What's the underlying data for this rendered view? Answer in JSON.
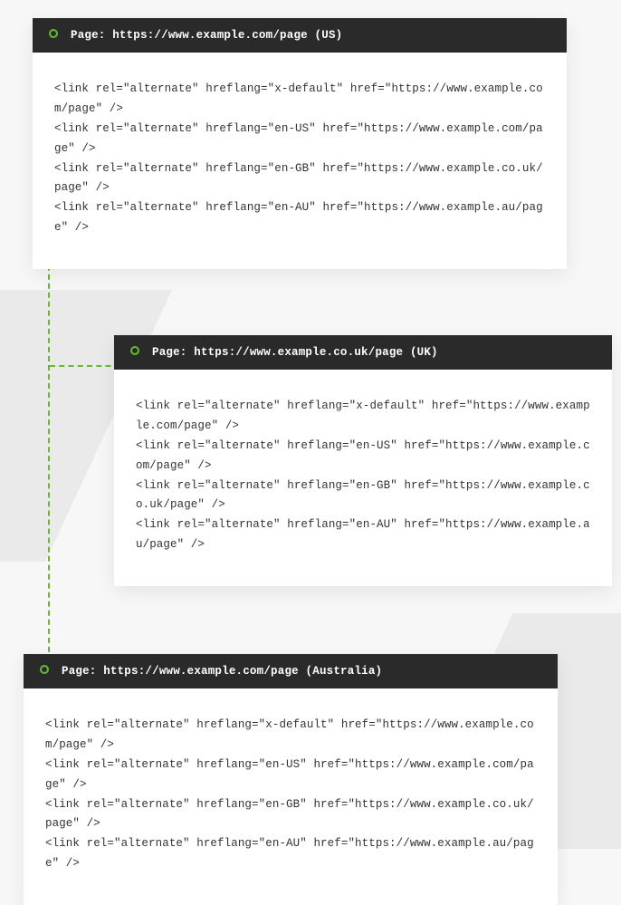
{
  "panels": {
    "us": {
      "title": "Page: https://www.example.com/page (US)",
      "lines": [
        "<link rel=\"alternate\" hreflang=\"x-default\" href=\"https://www.example.com/page\" />",
        "<link rel=\"alternate\" hreflang=\"en-US\" href=\"https://www.example.com/page\" />",
        "<link rel=\"alternate\" hreflang=\"en-GB\" href=\"https://www.example.co.uk/page\" />",
        "<link rel=\"alternate\" hreflang=\"en-AU\" href=\"https://www.example.au/page\" />"
      ]
    },
    "uk": {
      "title": "Page: https://www.example.co.uk/page (UK)",
      "lines": [
        "<link rel=\"alternate\" hreflang=\"x-default\" href=\"https://www.example.com/page\" />",
        "<link rel=\"alternate\" hreflang=\"en-US\" href=\"https://www.example.com/page\" />",
        "<link rel=\"alternate\" hreflang=\"en-GB\" href=\"https://www.example.co.uk/page\" />",
        "<link rel=\"alternate\" hreflang=\"en-AU\" href=\"https://www.example.au/page\" />"
      ]
    },
    "au": {
      "title": "Page: https://www.example.com/page (Australia)",
      "lines": [
        "<link rel=\"alternate\" hreflang=\"x-default\" href=\"https://www.example.com/page\" />",
        "<link rel=\"alternate\" hreflang=\"en-US\" href=\"https://www.example.com/page\" />",
        "<link rel=\"alternate\" hreflang=\"en-GB\" href=\"https://www.example.co.uk/page\" />",
        "<link rel=\"alternate\" hreflang=\"en-AU\" href=\"https://www.example.au/page\" />"
      ]
    }
  }
}
